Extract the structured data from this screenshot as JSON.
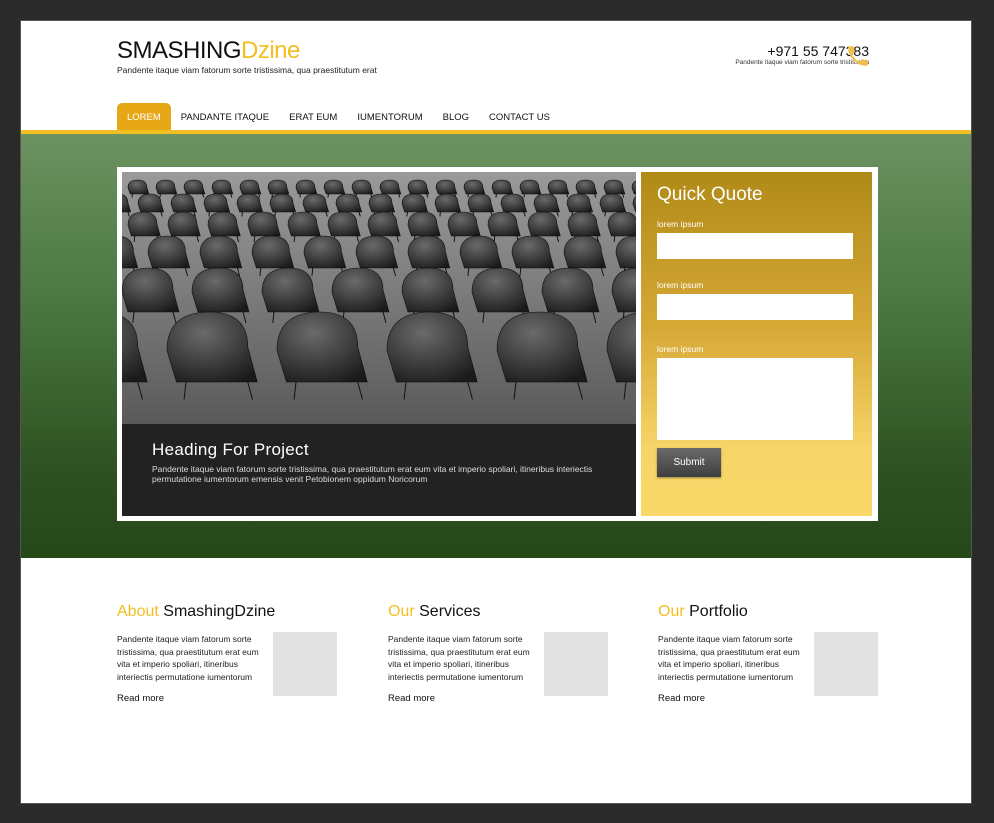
{
  "header": {
    "logo_primary": "SMASHING",
    "logo_accent": "Dzine",
    "tagline": "Pandente itaque viam fatorum sorte tristissima, qua praestitutum erat",
    "phone": "+971 55 747383",
    "phone_sub": "Pandente itaque viam fatorum sorte tristissima"
  },
  "nav": {
    "items": [
      {
        "label": "LOREM",
        "active": true
      },
      {
        "label": "PANDANTE ITAQUE"
      },
      {
        "label": "ERAT EUM"
      },
      {
        "label": "IUMENTORUM"
      },
      {
        "label": "BLOG"
      },
      {
        "label": "CONTACT US"
      }
    ]
  },
  "hero": {
    "caption_title": "Heading For Project",
    "caption_text": "Pandente itaque viam fatorum sorte tristissima, qua praestitutum erat eum vita et imperio spoliari, itineribus interiectis permutatione iumentorum emensis venit Petobionem oppidum Noricorum"
  },
  "quote": {
    "title": "Quick Quote",
    "label1": "lorem ipsum",
    "label2": "lorem ipsum",
    "label3": "lorem ipsum",
    "submit": "Submit"
  },
  "columns": [
    {
      "title_highlight": "About",
      "title_rest": "SmashingDzine",
      "text": "Pandente itaque viam fatorum sorte tristissima, qua praestitutum erat eum vita et imperio spoliari, itineribus interiectis permutatione iumentorum",
      "more": "Read more"
    },
    {
      "title_highlight": "Our",
      "title_rest": "Services",
      "text": "Pandente itaque viam fatorum sorte tristissima, qua praestitutum erat eum vita et imperio spoliari, itineribus interiectis permutatione iumentorum",
      "more": "Read more"
    },
    {
      "title_highlight": "Our",
      "title_rest": "Portfolio",
      "text": "Pandente itaque viam fatorum sorte tristissima, qua praestitutum erat eum vita et imperio spoliari, itineribus interiectis permutatione iumentorum",
      "more": "Read more"
    }
  ],
  "colors": {
    "accent": "#f2bf22",
    "nav_active": "#e6a716",
    "hero_top": "#6c9260",
    "hero_bottom": "#244818"
  },
  "icons": {
    "phone": "phone-icon"
  }
}
